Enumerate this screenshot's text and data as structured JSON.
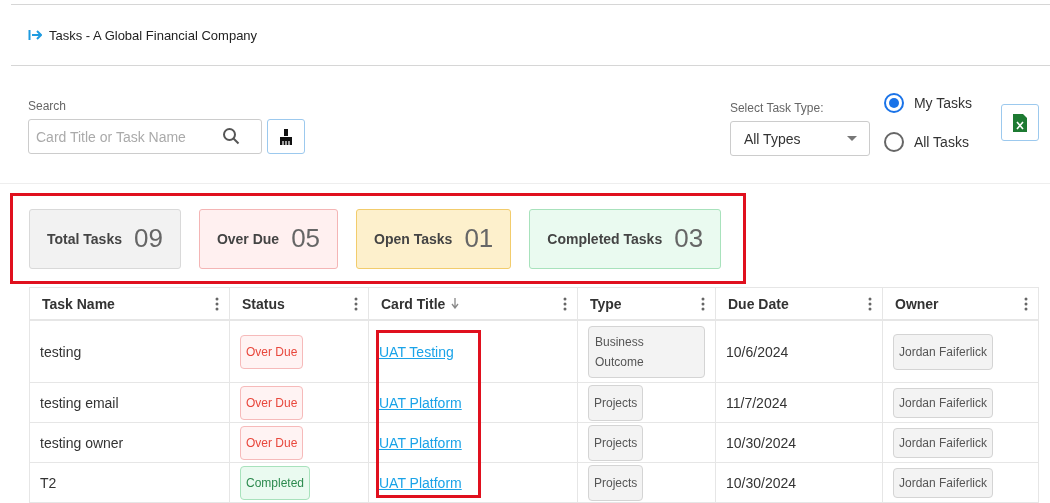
{
  "page_title": "Tasks - A Global Financial Company",
  "search": {
    "label": "Search",
    "placeholder": "Card Title or Task Name"
  },
  "task_type": {
    "label": "Select Task Type:",
    "value": "All Types"
  },
  "scope": [
    {
      "label": "My Tasks",
      "selected": true
    },
    {
      "label": "All Tasks",
      "selected": false
    }
  ],
  "summary": [
    {
      "kind": "total",
      "label": "Total Tasks",
      "count": "09"
    },
    {
      "kind": "overdue",
      "label": "Over Due",
      "count": "05"
    },
    {
      "kind": "open",
      "label": "Open Tasks",
      "count": "01"
    },
    {
      "kind": "completed",
      "label": "Completed Tasks",
      "count": "03"
    }
  ],
  "table": {
    "columns": [
      {
        "label": "Task Name",
        "sorted": false
      },
      {
        "label": "Status",
        "sorted": false
      },
      {
        "label": "Card Title",
        "sorted": true
      },
      {
        "label": "Type",
        "sorted": false
      },
      {
        "label": "Due Date",
        "sorted": false
      },
      {
        "label": "Owner",
        "sorted": false
      }
    ],
    "rows": [
      {
        "task_name": "testing",
        "status": {
          "kind": "overdue",
          "label": "Over Due"
        },
        "card_title": "UAT Testing",
        "type": "Business Outcome",
        "due_date": "10/6/2024",
        "owner": "Jordan Faiferlick"
      },
      {
        "task_name": "testing email",
        "status": {
          "kind": "overdue",
          "label": "Over Due"
        },
        "card_title": "UAT Platform",
        "type": "Projects",
        "due_date": "11/7/2024",
        "owner": "Jordan Faiferlick"
      },
      {
        "task_name": "testing owner",
        "status": {
          "kind": "overdue",
          "label": "Over Due"
        },
        "card_title": "UAT Platform",
        "type": "Projects",
        "due_date": "10/30/2024",
        "owner": "Jordan Faiferlick"
      },
      {
        "task_name": "T2",
        "status": {
          "kind": "completed",
          "label": "Completed"
        },
        "card_title": "UAT Platform",
        "type": "Projects",
        "due_date": "10/30/2024",
        "owner": "Jordan Faiferlick"
      }
    ]
  }
}
